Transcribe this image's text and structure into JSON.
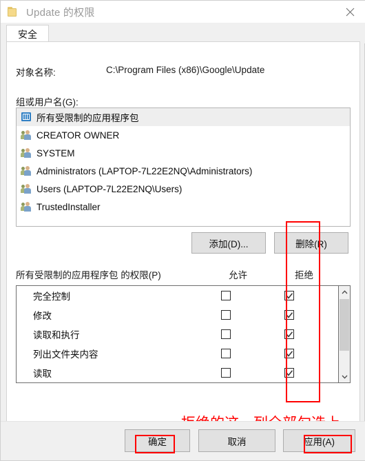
{
  "window": {
    "title": "Update 的权限",
    "icon": "folder-icon",
    "close_icon": "close-icon"
  },
  "tabs": [
    {
      "label": "安全",
      "active": true
    }
  ],
  "object": {
    "label": "对象名称:",
    "value": "C:\\Program Files (x86)\\Google\\Update"
  },
  "group_list": {
    "label": "组或用户名(G):",
    "items": [
      {
        "name": "所有受限制的应用程序包",
        "icon": "app-package-icon",
        "selected": true
      },
      {
        "name": "CREATOR OWNER",
        "icon": "users-icon",
        "selected": false
      },
      {
        "name": "SYSTEM",
        "icon": "users-icon",
        "selected": false
      },
      {
        "name": "Administrators (LAPTOP-7L22E2NQ\\Administrators)",
        "icon": "users-icon",
        "selected": false
      },
      {
        "name": "Users (LAPTOP-7L22E2NQ\\Users)",
        "icon": "users-icon",
        "selected": false
      },
      {
        "name": "TrustedInstaller",
        "icon": "users-icon",
        "selected": false
      }
    ]
  },
  "list_actions": {
    "add_label": "添加(D)...",
    "remove_label": "删除(R)"
  },
  "permissions": {
    "label": "所有受限制的应用程序包 的权限(P)",
    "allow_header": "允许",
    "deny_header": "拒绝",
    "rows": [
      {
        "name": "完全控制",
        "allow": false,
        "deny": true
      },
      {
        "name": "修改",
        "allow": false,
        "deny": true
      },
      {
        "name": "读取和执行",
        "allow": false,
        "deny": true
      },
      {
        "name": "列出文件夹内容",
        "allow": false,
        "deny": true
      },
      {
        "name": "读取",
        "allow": false,
        "deny": true
      }
    ],
    "scrollbar": {
      "up_icon": "chevron-up-icon",
      "down_icon": "chevron-down-icon"
    }
  },
  "annotation": {
    "text": "拒绝的这一列全部勾选上",
    "color": "#ff0000"
  },
  "footer": {
    "ok_label": "确定",
    "cancel_label": "取消",
    "apply_label": "应用(A)"
  }
}
